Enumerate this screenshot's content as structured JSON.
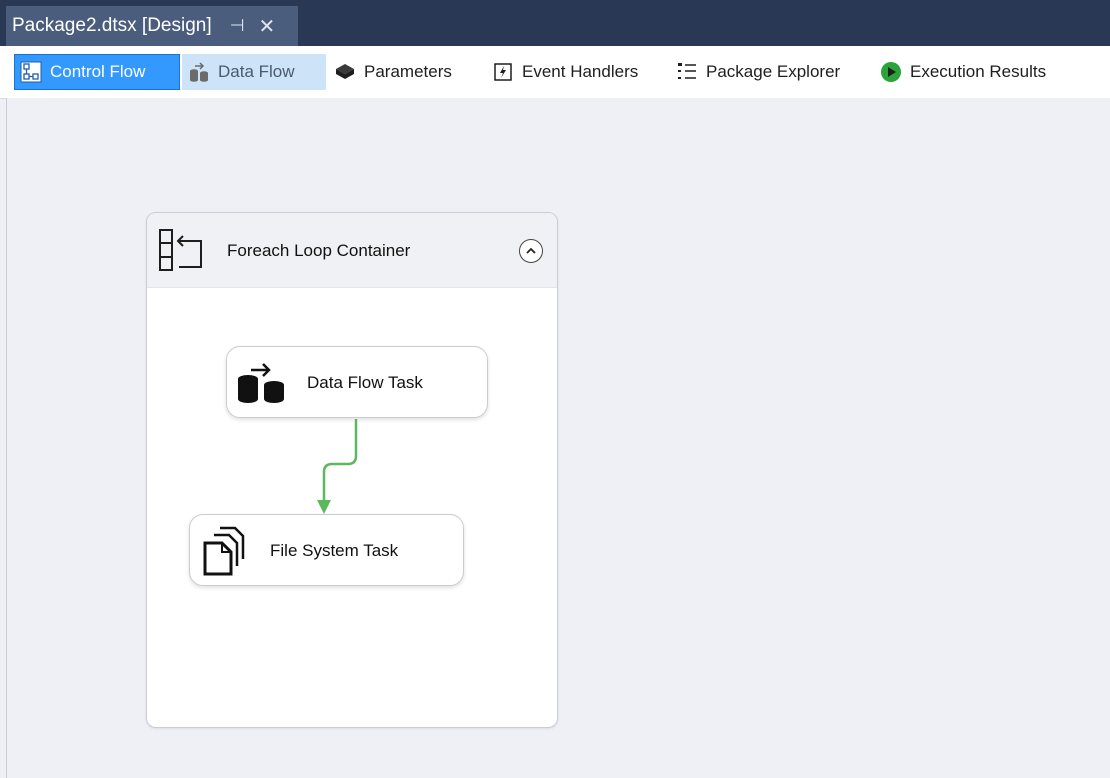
{
  "document_tab": {
    "title": "Package2.dtsx [Design]",
    "pin_symbol": "⊣",
    "close_symbol": "✕"
  },
  "designer_tabs": [
    {
      "label": "Control Flow",
      "icon": "control-flow-icon",
      "state": "selected"
    },
    {
      "label": "Data Flow",
      "icon": "data-flow-icon",
      "state": "hover"
    },
    {
      "label": "Parameters",
      "icon": "parameters-icon",
      "state": "normal"
    },
    {
      "label": "Event Handlers",
      "icon": "event-handlers-icon",
      "state": "normal"
    },
    {
      "label": "Package Explorer",
      "icon": "package-explorer-icon",
      "state": "normal"
    },
    {
      "label": "Execution Results",
      "icon": "execution-results-icon",
      "state": "normal"
    }
  ],
  "canvas": {
    "container": {
      "title": "Foreach Loop Container",
      "icon": "foreach-loop-icon",
      "collapse_icon": "chevron-up-icon"
    },
    "tasks": [
      {
        "label": "Data Flow Task",
        "icon": "data-flow-task-icon"
      },
      {
        "label": "File System Task",
        "icon": "file-system-task-icon"
      }
    ],
    "precedence_constraint": {
      "from": "Data Flow Task",
      "to": "File System Task",
      "color": "#5cb85c"
    }
  },
  "colors": {
    "title_bar": "#293955",
    "active_tab": "#3399ff",
    "hover_tab": "#cde3f7",
    "canvas": "#eef0f5",
    "success_arrow": "#5cb85c"
  }
}
